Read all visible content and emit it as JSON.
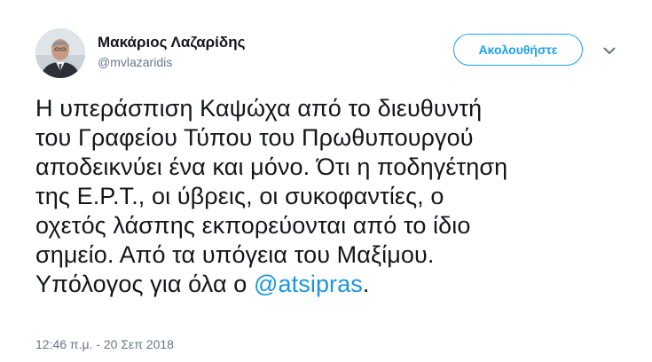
{
  "author": {
    "display_name": "Μακάριος Λαζαρίδης",
    "handle": "@mvlazaridis"
  },
  "actions": {
    "follow_label": "Ακολουθήστε",
    "menu_icon": "chevron-down-icon"
  },
  "tweet": {
    "lines": [
      "Η υπεράσπιση Καψώχα από το διευθυντή",
      "του Γραφείου Τύπου του Πρωθυπουργού",
      "αποδεικνύει ένα και μόνο. Ότι η ποδηγέτηση",
      "της Ε.Ρ.Τ., οι ύβρεις, οι συκοφαντίες, ο",
      "οχετός λάσπης εκπορεύονται από το ίδιο",
      "σημείο. Από τα υπόγεια του Μαξίμου."
    ],
    "last_line_prefix": "Υπόλογος για όλα ο ",
    "mention": "@atsipras",
    "last_line_suffix": "."
  },
  "timestamp": "12:46 π.μ. - 20 Σεπ 2018",
  "colors": {
    "accent": "#1da1f2",
    "mention": "#1b95e0",
    "secondary_text": "#657786",
    "primary_text": "#14171a"
  }
}
